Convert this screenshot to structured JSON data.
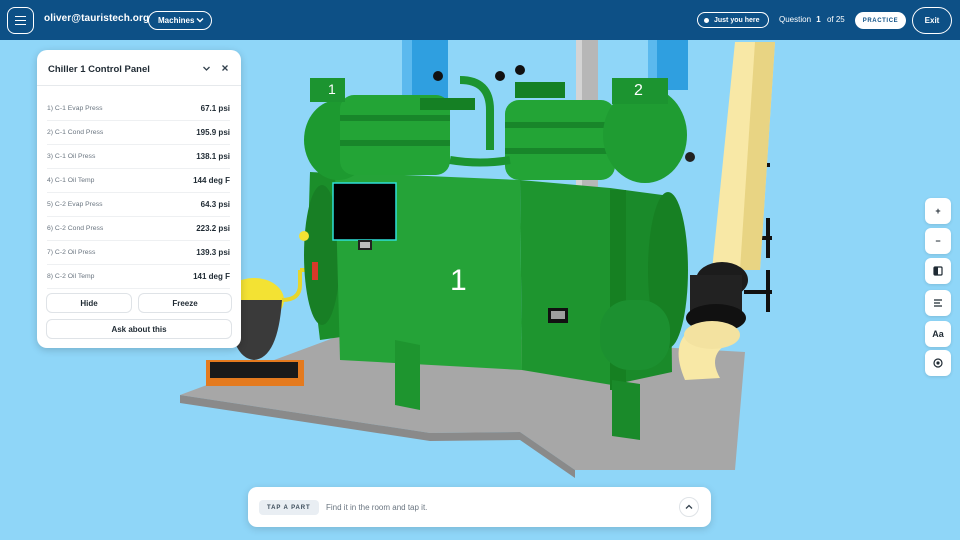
{
  "header": {
    "user": "oliver@tauristech.org",
    "machines_label": "Machines",
    "you_here_label": "Just you here",
    "question_label": "Question",
    "question_current": "1",
    "question_total": "of 25",
    "practice_label": "PRACTICE",
    "exit_label": "Exit"
  },
  "panel": {
    "title": "Chiller 1 Control Panel",
    "readings": [
      {
        "label": "1) C-1 Evap Press",
        "value": "67.1 psi"
      },
      {
        "label": "2) C-1 Cond Press",
        "value": "195.9 psi"
      },
      {
        "label": "3) C-1 Oil Press",
        "value": "138.1 psi"
      },
      {
        "label": "4) C-1 Oil Temp",
        "value": "144 deg F"
      },
      {
        "label": "5) C-2 Evap Press",
        "value": "64.3 psi"
      },
      {
        "label": "6) C-2 Cond Press",
        "value": "223.2 psi"
      },
      {
        "label": "7) C-2 Oil Press",
        "value": "139.3 psi"
      },
      {
        "label": "8) C-2 Oil Temp",
        "value": "141 deg F"
      }
    ],
    "hide_label": "Hide",
    "freeze_label": "Freeze",
    "ask_label": "Ask about this"
  },
  "scene": {
    "compressor_1_label": "1",
    "compressor_2_label": "2",
    "chiller_label": "1"
  },
  "tools": {
    "zoom_in": "+",
    "zoom_out": "−",
    "text_size": "Aa"
  },
  "prompt": {
    "tag_label": "TAP A PART",
    "hint": "Find it in the room and tap it."
  },
  "colors": {
    "header_bg": "#0d5086",
    "sky": "#8fd6f8",
    "machine_green": "#1e9a30",
    "floor": "#a9a9a9"
  },
  "icons": [
    "menu-icon",
    "chevron-down-icon",
    "presence-dot-icon",
    "close-icon",
    "contrast-icon",
    "list-icon",
    "target-icon",
    "chevron-up-icon"
  ]
}
